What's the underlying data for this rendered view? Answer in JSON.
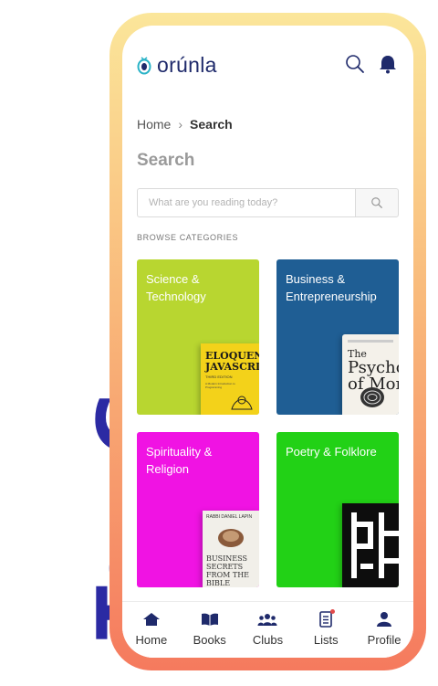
{
  "side_title": "Top Genres",
  "app": {
    "brand": "orúnla",
    "brand_color": "#1f2a6b"
  },
  "header": {
    "search_icon": "search-icon",
    "notification_icon": "bell-icon"
  },
  "breadcrumb": {
    "home": "Home",
    "separator": "›",
    "current": "Search"
  },
  "page_title": "Search",
  "search": {
    "placeholder": "What are you reading today?",
    "value": ""
  },
  "section_label": "BROWSE CATEGORIES",
  "categories": [
    {
      "label": "Science & Technology",
      "color": "#b8d630",
      "book": {
        "title_line1": "ELOQUENT",
        "title_line2": "JAVASCRIPT",
        "edition": "THIRD EDITION",
        "subtitle": "A Modern Introduction to Programming"
      }
    },
    {
      "label": "Business & Entrepreneurship",
      "color": "#1f5e94",
      "book": {
        "title_line1": "The",
        "title_line2": "Psychology of Money"
      }
    },
    {
      "label": "Spirituality & Religion",
      "color": "#f013e3",
      "book": {
        "author": "RABBI DANIEL LAPIN",
        "title": "BUSINESS SECRETS FROM THE BIBLE"
      }
    },
    {
      "label": "Poetry & Folklore",
      "color": "#22d116",
      "book": {}
    },
    {
      "label": "",
      "color": "#a8158a"
    },
    {
      "label": "",
      "color": "#72e6e0"
    }
  ],
  "tabbar": [
    {
      "label": "Home",
      "icon": "home-icon"
    },
    {
      "label": "Books",
      "icon": "book-icon"
    },
    {
      "label": "Clubs",
      "icon": "clubs-icon"
    },
    {
      "label": "Lists",
      "icon": "list-icon"
    },
    {
      "label": "Profile",
      "icon": "profile-icon"
    }
  ],
  "colors": {
    "side_title": "#2b2aa3",
    "frame_top": "#fbe69a",
    "frame_bottom": "#f57a5e"
  }
}
